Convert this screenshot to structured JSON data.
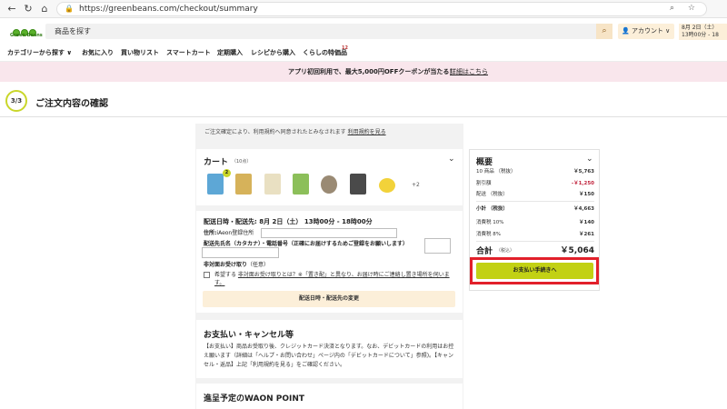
{
  "browser": {
    "url": "https://greenbeans.com/checkout/summary"
  },
  "header": {
    "logo_text": "Green Beans",
    "search_placeholder": "商品を探す",
    "account_label": "アカウント",
    "delivery_line1": "8月 2日（土）",
    "delivery_line2": "13時00分 - 18"
  },
  "nav": {
    "items": [
      "カテゴリーから探す ∨",
      "お気に入り",
      "買い物リスト",
      "スマートカート",
      "定期購入",
      "レシピから購入",
      "くらしの特価品"
    ],
    "badge": "12"
  },
  "promo": {
    "text": "アプリ初回利用で、最大5,000円OFFクーポンが当たる！",
    "link": "詳細はこちら"
  },
  "page": {
    "step": "3/3",
    "title": "ご注文内容の確認",
    "terms_note": "ご注文確定により、利用規約へ同意されたとみなされます ",
    "terms_link": "利用規約を見る"
  },
  "cart": {
    "title": "カート",
    "count": "（10点）",
    "badge": "2",
    "more": "+2",
    "thumb_colors": [
      "#5da7d6",
      "#d6b25a",
      "#e9e0c2",
      "#8cbf5a",
      "#9a8a74",
      "#4a4a4a",
      "#f2d23a"
    ]
  },
  "shipping": {
    "title": "配送日時・配送先: 8月 2日（土） 13時00分 - 18時00分",
    "address_label": "住所:",
    "address_value": "iAeon登録住所",
    "kana_label": "配送先氏名（カタカナ）・電話番号（正確にお届けするためご登録をお願いします）",
    "nonface_title": "非対面お受け取り",
    "nonface_optional": "（任意）",
    "check_text_pre": "希望する ",
    "check_link": "非対面お受け取りとは？※「置き配」と異なり、お届け時にご連絡し置き場所を伺います。",
    "change_button": "配送日時・配送先の変更"
  },
  "payment": {
    "title": "お支払い・キャンセル等",
    "text": "【お支払い】商品お受取り後、クレジットカード決済となります。なお、デビットカードの利用はお控え願います（詳細は「ヘルプ・お問い合わせ」ページ内の「デビットカードについて」参照)。【キャンセル・返品】上記「利用規約を見る」をご確認ください。"
  },
  "waon": {
    "title": "進呈予定のWAON POINT"
  },
  "summary": {
    "title": "概要",
    "rows": [
      {
        "label": "10 商品 （税抜）",
        "value": "￥5,763"
      },
      {
        "label": "割引額",
        "value": "-￥1,250"
      },
      {
        "label": "配送 （税抜）",
        "value": "￥150"
      },
      {
        "label": "小計 （税抜）",
        "value": "￥4,663"
      },
      {
        "label": "消費税 10%",
        "value": "￥140"
      },
      {
        "label": "消費税 8%",
        "value": "￥261"
      }
    ],
    "total_label": "合計",
    "total_tax": "（税込）",
    "total_value": "￥5,064",
    "pay_button": "お支払い手続きへ",
    "discount_color": "#c0223b",
    "accent_color": "#c2d114"
  }
}
